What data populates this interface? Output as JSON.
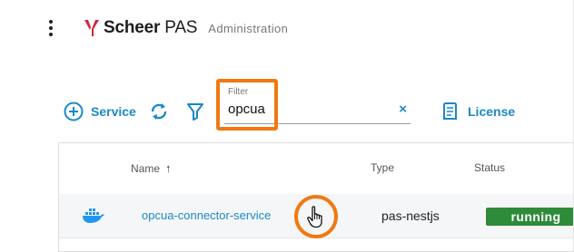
{
  "header": {
    "brand_bold": "Scheer",
    "brand_light": " PAS",
    "subtitle": "Administration"
  },
  "toolbar": {
    "add_service_label": "Service",
    "filter": {
      "label": "Filter",
      "value": "opcua",
      "clear_icon": "×"
    },
    "license_label": "License"
  },
  "table": {
    "columns": {
      "name": "Name",
      "name_sort_icon": "↑",
      "type": "Type",
      "status": "Status"
    },
    "rows": [
      {
        "icon": "docker-icon",
        "name": "opcua-connector-service",
        "type": "pas-nestjs",
        "status": "running"
      }
    ]
  },
  "colors": {
    "accent": "#1a88c9",
    "highlight": "#ee7a12",
    "status_running": "#2e8b39",
    "brand_red": "#d0263a"
  }
}
